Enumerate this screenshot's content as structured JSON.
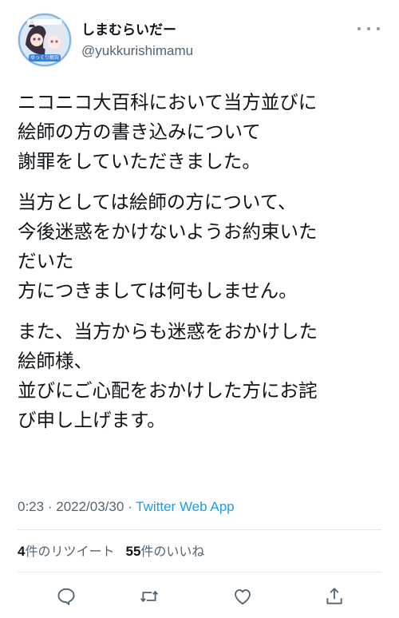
{
  "author": {
    "display_name": "しまむらいだー",
    "handle": "@yukkurishimamu",
    "avatar_icon": "avatar-illustration",
    "avatar_badge_text": "ゆっくり解説"
  },
  "tweet": {
    "paragraphs": [
      {
        "lines": [
          "ニコニコ大百科において当方並びに",
          "絵師の方の書き込みについて",
          "謝罪をしていただきました。"
        ]
      },
      {
        "lines": [
          "当方としては絵師の方について、",
          "今後迷惑をかけないようお約束いた",
          "だいた",
          "方につきましては何もしません。"
        ]
      },
      {
        "lines": [
          "また、当方からも迷惑をおかけした",
          "絵師様、",
          "並びにご心配をおかけした方にお詫",
          "び申し上げます。"
        ]
      }
    ]
  },
  "meta": {
    "time": "0:23",
    "separator": "·",
    "date": "2022/03/30",
    "source": "Twitter Web App"
  },
  "stats": {
    "retweets": "4",
    "retweets_label": "件のリツイート",
    "likes": "55",
    "likes_label": "件のいいね"
  },
  "actions": {
    "reply_icon": "reply-icon",
    "retweet_icon": "retweet-icon",
    "like_icon": "like-icon",
    "share_icon": "share-icon"
  },
  "colors": {
    "text_primary": "#0f1419",
    "text_secondary": "#536471",
    "link": "#1d9bf0",
    "divider": "#e1e8ed"
  }
}
